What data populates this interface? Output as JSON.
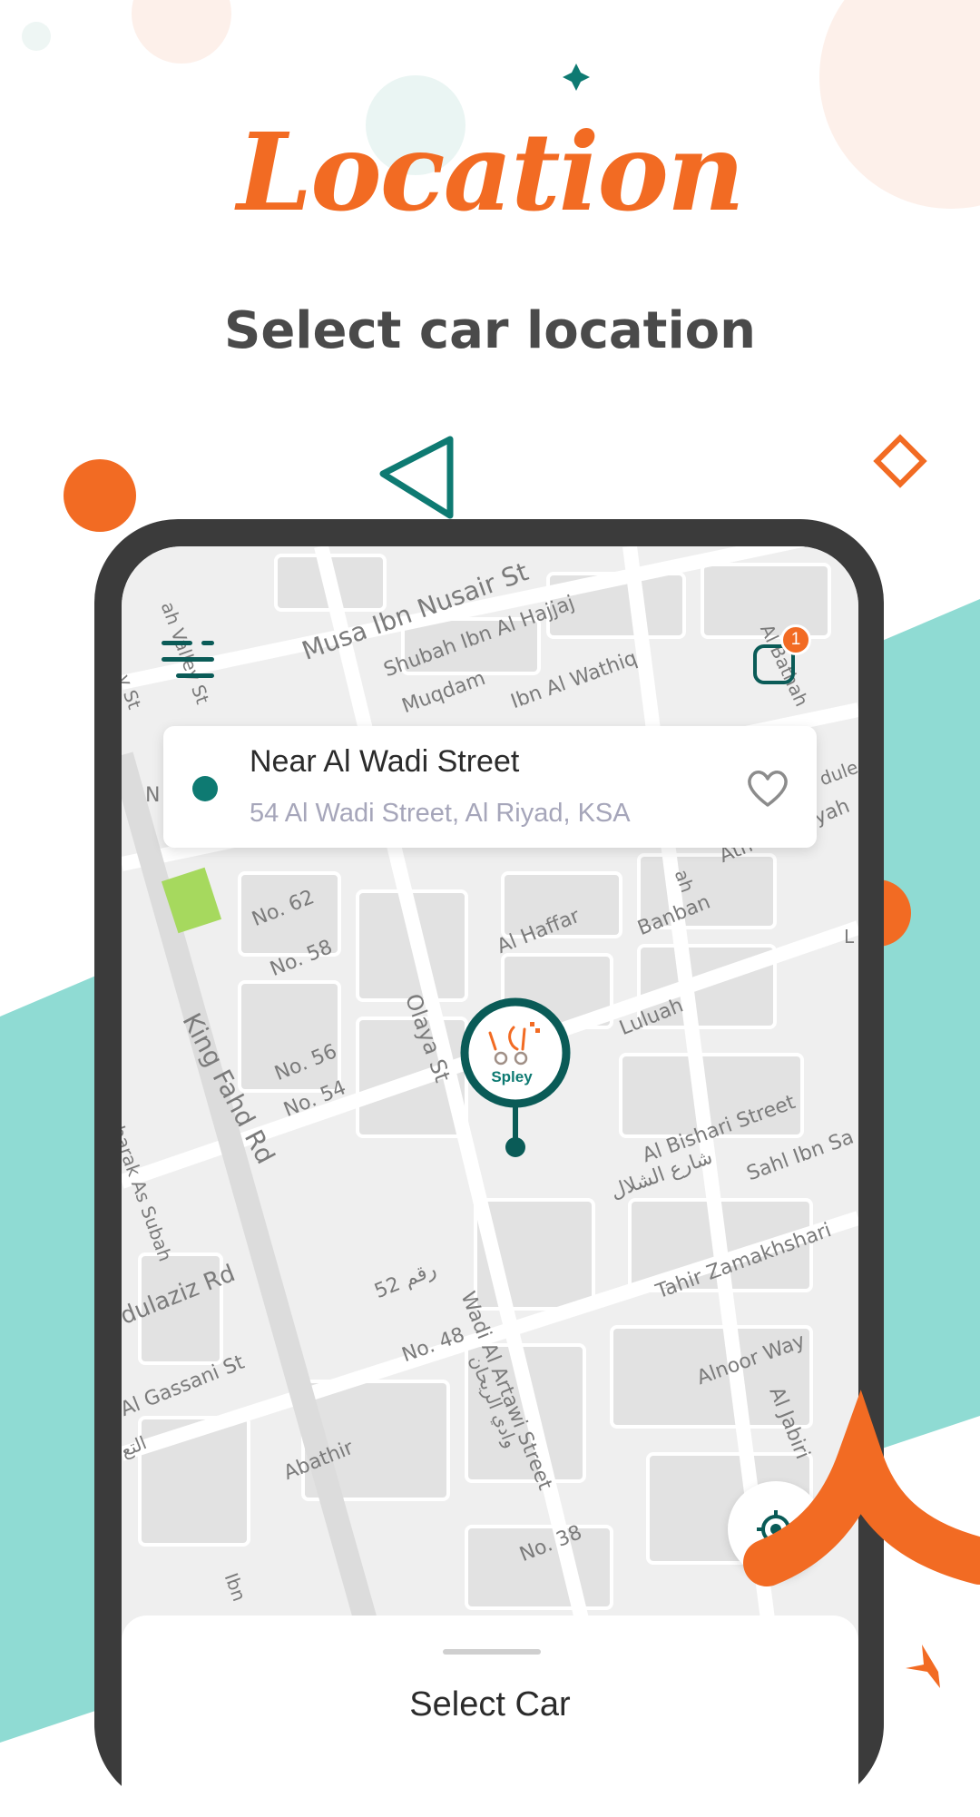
{
  "header": {
    "script_title": "Location",
    "subtitle": "Select car location"
  },
  "colors": {
    "accent_orange": "#f26b23",
    "brand_teal": "#0a5b57",
    "background_teal": "#8fdbd3"
  },
  "map": {
    "streets": [
      "Musa Ibn Nusair St",
      "Shubah Ibn Al Hajjaj",
      "Muqdam",
      "Ibn Al Wathiq",
      "Al Bathah",
      "ah Valley St",
      "y St",
      "No. 62",
      "No. 58",
      "No. 56",
      "No. 54",
      "King Fahd Rd",
      "Olaya St",
      "Al Haffar",
      "Banban",
      "Ath Thanyyah",
      "Luluah",
      "Al Bishari Street",
      "شارع الشلال",
      "Sahl Ibn Sa",
      "Shaikh Mubarak As Subah",
      "dulaziz Rd",
      "رقم 52",
      "Wadi Al Artawi Street",
      "وادي الريحان",
      "Tahir Zamakhshari",
      "No. 48",
      "Alnoor Way",
      "Al Jabiri",
      "Al Gassani St",
      "Abathir",
      "No. 38",
      "Ibn",
      "التع",
      "N",
      "ah",
      "dule",
      "L"
    ]
  },
  "top_bar": {
    "menu_icon": "menu-icon",
    "bag_icon": "bag-icon",
    "bag_count": "1"
  },
  "location_card": {
    "name": "Near Al Wadi Street",
    "address": "54 Al Wadi Street, Al Riyad, KSA",
    "favorite_icon": "heart-icon"
  },
  "pin": {
    "brand_text": "Spley"
  },
  "bottom_sheet": {
    "title": "Select Car"
  }
}
